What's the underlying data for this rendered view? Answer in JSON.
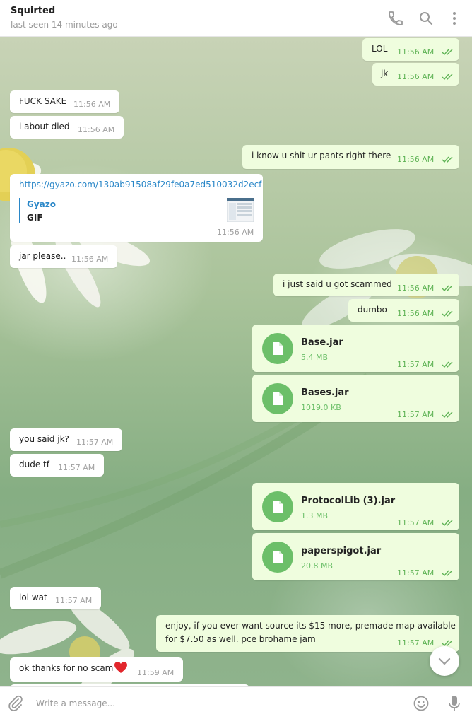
{
  "header": {
    "name": "Squirted",
    "status": "last seen 14 minutes ago",
    "icons": [
      "phone-icon",
      "search-icon",
      "more-vertical-icon"
    ]
  },
  "messages": [
    {
      "dir": "out",
      "text": "LOL",
      "time": "11:56 AM"
    },
    {
      "dir": "out",
      "text": "jk",
      "time": "11:56 AM"
    },
    {
      "dir": "in",
      "text": "FUCK SAKE",
      "time": "11:56 AM"
    },
    {
      "dir": "in",
      "text": "i about died",
      "time": "11:56 AM"
    },
    {
      "dir": "out",
      "text": "i know u shit ur pants right there",
      "time": "11:56 AM"
    },
    {
      "dir": "in",
      "type": "link",
      "url": "https://gyazo.com/130ab91508af29fe0a7ed510032d2ecf",
      "preview_site": "Gyazo",
      "preview_title": "GIF",
      "time": "11:56 AM"
    },
    {
      "dir": "in",
      "text": "jar please..",
      "time": "11:56 AM"
    },
    {
      "dir": "out",
      "text": "i just said u got scammed",
      "time": "11:56 AM"
    },
    {
      "dir": "out",
      "text": "dumbo",
      "time": "11:56 AM"
    },
    {
      "dir": "out",
      "type": "file",
      "name": "Base.jar",
      "size": "5.4 MB",
      "time": "11:57 AM"
    },
    {
      "dir": "out",
      "type": "file",
      "name": "Bases.jar",
      "size": "1019.0 KB",
      "time": "11:57 AM"
    },
    {
      "dir": "in",
      "text": "you said jk?",
      "time": "11:57 AM"
    },
    {
      "dir": "in",
      "text": "dude tf",
      "time": "11:57 AM"
    },
    {
      "dir": "out",
      "type": "file",
      "name": "ProtocolLib (3).jar",
      "size": "1.3 MB",
      "time": "11:57 AM"
    },
    {
      "dir": "out",
      "type": "file",
      "name": "paperspigot.jar",
      "size": "20.8 MB",
      "time": "11:57 AM"
    },
    {
      "dir": "in",
      "text": "lol wat",
      "time": "11:57 AM"
    },
    {
      "dir": "out",
      "text_line1": "enjoy, if you ever want source its $15 more, premade map available",
      "text_line2": "for $7.50 as well. pce brohame jam",
      "time": "11:57 AM"
    },
    {
      "dir": "in",
      "text": "ok thanks for no scam",
      "emoji": "heart",
      "time": "11:59 AM"
    }
  ],
  "composer": {
    "placeholder": "Write a message...",
    "icons": [
      "attach-icon",
      "emoji-icon",
      "microphone-icon"
    ]
  },
  "colors": {
    "outgoing_bubble": "#effdde",
    "incoming_bubble": "#ffffff",
    "accent_green": "#6cbf69",
    "link_blue": "#2a87c8"
  }
}
